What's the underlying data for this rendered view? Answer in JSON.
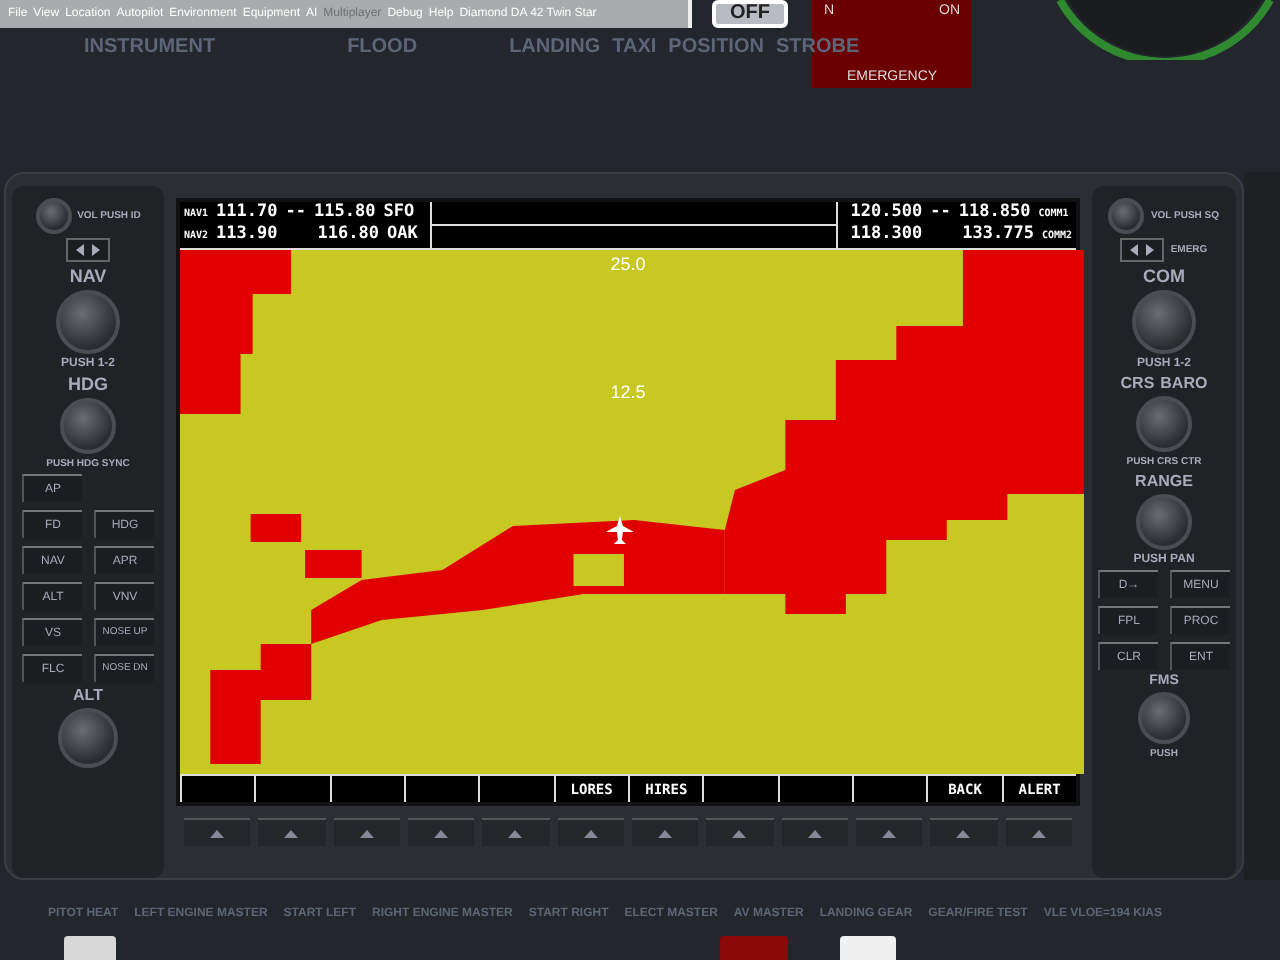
{
  "menu": {
    "items": [
      {
        "label": "File",
        "disabled": false
      },
      {
        "label": "View",
        "disabled": false
      },
      {
        "label": "Location",
        "disabled": false
      },
      {
        "label": "Autopilot",
        "disabled": false
      },
      {
        "label": "Environment",
        "disabled": false
      },
      {
        "label": "Equipment",
        "disabled": false
      },
      {
        "label": "AI",
        "disabled": false
      },
      {
        "label": "Multiplayer",
        "disabled": true
      },
      {
        "label": "Debug",
        "disabled": false
      },
      {
        "label": "Help",
        "disabled": false
      }
    ],
    "title": "Diamond DA 42 Twin Star"
  },
  "top_panel": {
    "labels": [
      "INSTRUMENT",
      "FLOOD",
      "LANDING",
      "TAXI",
      "POSITION",
      "STROBE"
    ],
    "switch_label": "OFF",
    "switch_on": false,
    "emergency": {
      "off_label": "N",
      "on_label": "ON",
      "title": "EMERGENCY"
    }
  },
  "screen": {
    "nav": [
      {
        "label": "NAV1",
        "freq_1": "111.70",
        "separator": "--",
        "freq_2": "115.80",
        "ident": "SFO"
      },
      {
        "label": "NAV2",
        "freq_1": "113.90",
        "freq_2": "116.80",
        "ident": "OAK"
      }
    ],
    "com": [
      {
        "freq_1": "120.500",
        "separator": "--",
        "freq_2": "118.850",
        "label": "COMM1"
      },
      {
        "freq_1": "118.300",
        "freq_2": "133.775",
        "label": "COMM2"
      }
    ],
    "range_labels": [
      "25.0",
      "12.5"
    ],
    "softkeys": [
      {
        "kind": "blank"
      },
      {
        "kind": "blank"
      },
      {
        "kind": "blank"
      },
      {
        "kind": "blank"
      },
      {
        "kind": "blank"
      },
      {
        "kind": "labeled",
        "label": "LORES"
      },
      {
        "kind": "labeled",
        "label": "HIRES"
      },
      {
        "kind": "blank"
      },
      {
        "kind": "blank"
      },
      {
        "kind": "blank"
      },
      {
        "kind": "labeled",
        "label": "BACK"
      },
      {
        "kind": "labeled",
        "label": "ALERT"
      }
    ]
  },
  "left_bezel": {
    "vol_label": "VOL PUSH ID",
    "nav_label": "NAV",
    "nav_push": "PUSH 1-2",
    "hdg_label": "HDG",
    "hdg_push": "PUSH HDG SYNC",
    "buttons": [
      [
        "AP"
      ],
      [
        "FD",
        "HDG"
      ],
      [
        "NAV",
        "APR"
      ],
      [
        "ALT",
        "VNV"
      ],
      [
        "VS",
        "NOSE UP"
      ],
      [
        "FLC",
        "NOSE DN"
      ]
    ],
    "alt_label": "ALT"
  },
  "right_bezel": {
    "vol_label": "VOL PUSH SQ",
    "emerg_label": "EMERG",
    "com_label": "COM",
    "com_push": "PUSH 1-2",
    "crs_label": "CRS",
    "baro_label": "BARO",
    "crs_push": "PUSH CRS CTR",
    "range_label": "RANGE",
    "range_push": "PUSH PAN",
    "buttons": [
      [
        "D→",
        "MENU"
      ],
      [
        "FPL",
        "PROC"
      ],
      [
        "CLR",
        "ENT"
      ]
    ],
    "fms_label": "FMS",
    "fms_push": "PUSH"
  },
  "bottom_panel": {
    "switches": [
      {
        "color": "#d8d8d8",
        "on": false
      },
      {
        "color": "#8a0a0a",
        "on": false
      },
      {
        "color": "#f0f0f0",
        "on": false
      }
    ],
    "labels": [
      "PITOT HEAT",
      "LEFT ENGINE MASTER",
      "START LEFT",
      "RIGHT ENGINE MASTER",
      "START RIGHT",
      "ELECT MASTER",
      "AV MASTER",
      "LANDING GEAR",
      "GEAR/FIRE TEST",
      "VLE VLOE=194 KIAS"
    ]
  }
}
